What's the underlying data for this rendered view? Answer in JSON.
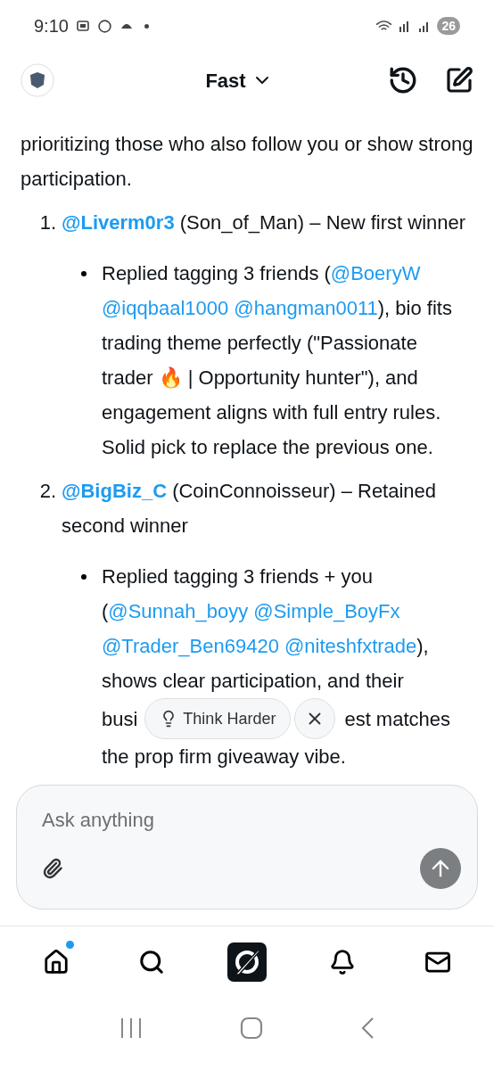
{
  "status_bar": {
    "time": "9:10",
    "battery": "26"
  },
  "header": {
    "model": "Fast"
  },
  "message": {
    "intro": "prioritizing those who also follow you or show strong participation.",
    "winners": [
      {
        "number": "1.",
        "handle": "@Liverm0r3",
        "rest": " (Son_of_Man) – New first winner",
        "details": [
          {
            "segments": [
              {
                "kind": "text",
                "text": "Replied tagging 3 friends ("
              },
              {
                "kind": "mention",
                "text": "@BoeryW"
              },
              {
                "kind": "mention",
                "text": "@iqqbaal1000"
              },
              {
                "kind": "mention",
                "text": "@hangman0011"
              },
              {
                "kind": "text",
                "text": "), bio fits trading theme perfectly (\"Passionate trader 🔥 | Opportunity hunter\"), and engagement aligns with full entry rules. Solid pick to replace the previous one."
              }
            ]
          }
        ]
      },
      {
        "number": "2.",
        "handle": "@BigBiz_C",
        "rest": " (CoinConnoisseur) – Retained second winner",
        "details": [
          {
            "segments": [
              {
                "kind": "text",
                "text": "Replied tagging 3 friends + you ("
              },
              {
                "kind": "mention",
                "text": "@Sunnah_boyy"
              },
              {
                "kind": "mention",
                "text": "@Simple_BoyFx"
              },
              {
                "kind": "mention",
                "text": "@Trader_Ben69420"
              },
              {
                "kind": "mention",
                "text": "@niteshfxtrade"
              },
              {
                "kind": "text",
                "text": "), shows clear participation, and their"
              }
            ],
            "covered": {
              "before": "busi",
              "after": "est matches",
              "last_line": "the prop firm giveaway vibe."
            }
          }
        ]
      }
    ]
  },
  "suggestion": {
    "label": "Think Harder"
  },
  "composer": {
    "placeholder": "Ask anything"
  },
  "bottom_nav": [
    {
      "kind": "home",
      "badge": true
    },
    {
      "kind": "search",
      "badge": false
    },
    {
      "kind": "grok",
      "badge": false
    },
    {
      "kind": "notifications",
      "badge": false
    },
    {
      "kind": "messages",
      "badge": false
    }
  ]
}
